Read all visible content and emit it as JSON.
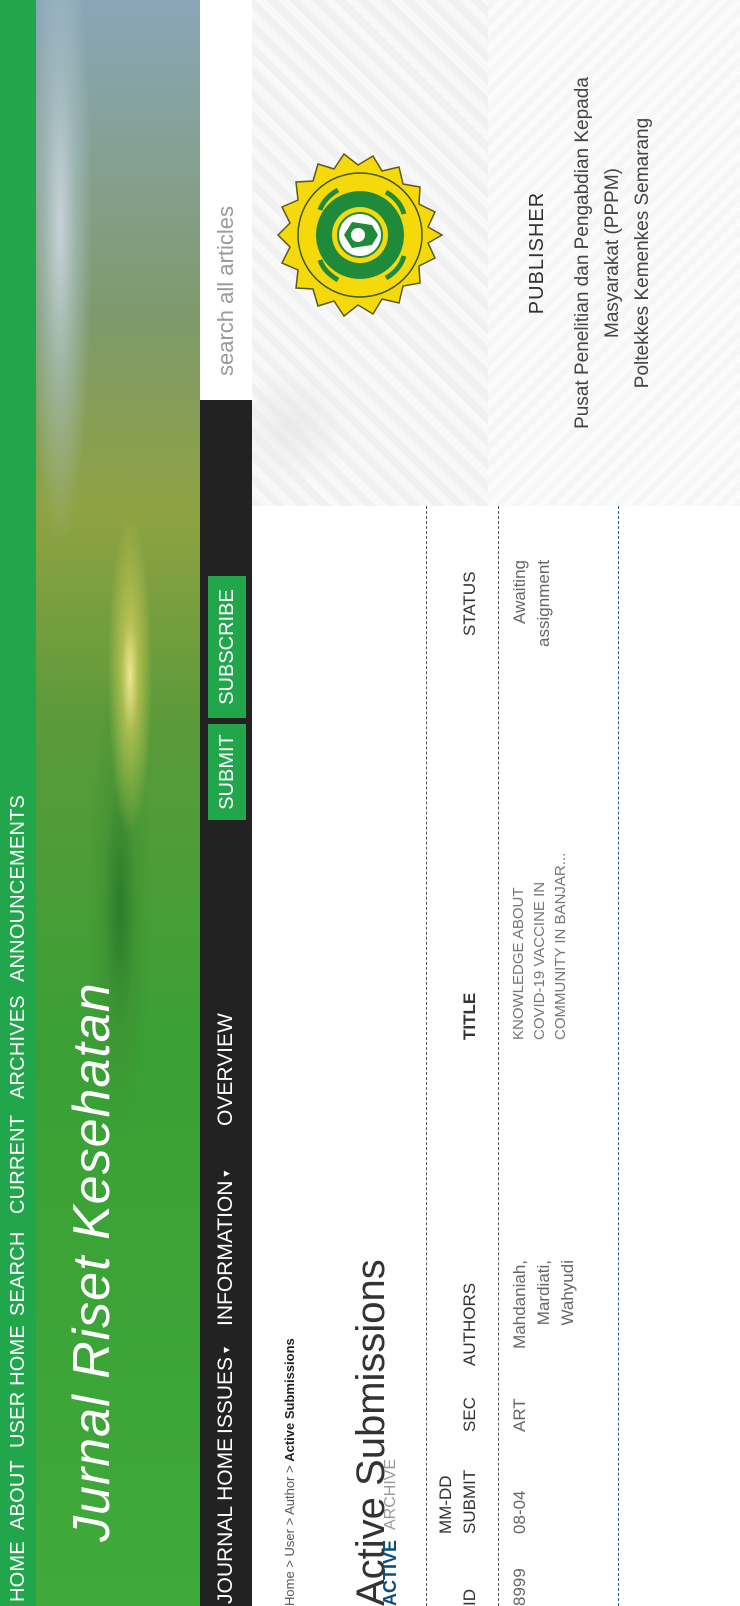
{
  "top_nav": {
    "items": [
      "HOME",
      "ABOUT",
      "USER HOME",
      "SEARCH",
      "CURRENT",
      "ARCHIVES",
      "ANNOUNCEMENTS"
    ]
  },
  "site": {
    "title": "Jurnal Riset Kesehatan"
  },
  "main_nav": {
    "journal_home": "JOURNAL HOME",
    "issues": "ISSUES",
    "information": "INFORMATION",
    "overview": "OVERVIEW",
    "submit": "SUBMIT",
    "subscribe": "SUBSCRIBE",
    "caret": "▾"
  },
  "search": {
    "placeholder": "search all articles"
  },
  "breadcrumb": {
    "home": "Home",
    "user": "User",
    "author": "Author",
    "current": "Active Submissions",
    "separator": " > "
  },
  "page": {
    "title": "Active Submissions",
    "tabs": {
      "active": "ACTIVE",
      "archive": "ARCHIVE"
    }
  },
  "table": {
    "headers": {
      "id": "ID",
      "submit_top": "MM-DD",
      "submit_bottom": "SUBMIT",
      "sec": "SEC",
      "authors": "AUTHORS",
      "title": "TITLE",
      "status": "STATUS"
    },
    "rows": [
      {
        "id": "8999",
        "submit": "08-04",
        "sec": "ART",
        "authors": [
          "Mahdaniah,",
          "Mardiati,",
          "Wahyudi"
        ],
        "title": [
          "KNOWLEDGE ABOUT",
          "COVID-19 VACCINE IN",
          "COMMUNITY IN BANJAR..."
        ],
        "status": [
          "Awaiting",
          "assignment"
        ]
      }
    ]
  },
  "sidebar": {
    "logo_alt": "Politeknik Kesehatan Semarang logo",
    "publisher_label": "PUBLISHER",
    "publisher_name": [
      "Pusat Penelitian dan Pengabdian Kepada",
      "Masyarakat (PPPM)",
      "Poltekkes Kemenkes Semarang"
    ]
  },
  "colors": {
    "nav_green": "#22a64b",
    "nav_dark": "#222222",
    "active_tab": "#0d4f7a",
    "logo_yellow": "#f5d90a",
    "logo_green": "#1f8a3a"
  }
}
